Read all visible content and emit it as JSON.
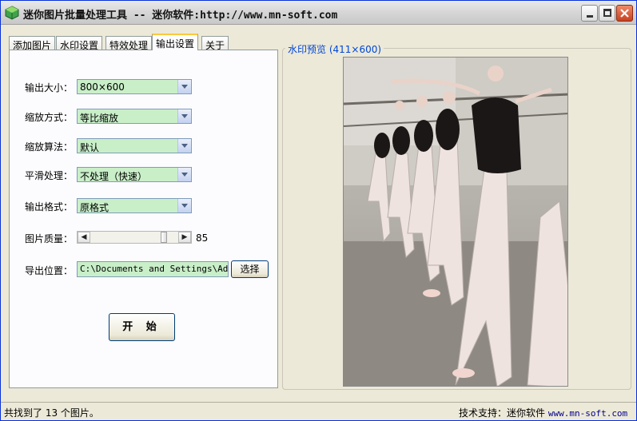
{
  "window": {
    "title": "迷你图片批量处理工具 -- 迷你软件:http://www.mn-soft.com"
  },
  "tabs": [
    {
      "label": "添加图片",
      "active": false
    },
    {
      "label": "水印设置",
      "active": false
    },
    {
      "label": "特效处理",
      "active": false
    },
    {
      "label": "输出设置",
      "active": true
    },
    {
      "label": "关于",
      "active": false
    }
  ],
  "output_settings": {
    "size_label": "输出大小：",
    "size_value": "800×600",
    "scale_mode_label": "缩放方式：",
    "scale_mode_value": "等比缩放",
    "scale_algo_label": "缩放算法：",
    "scale_algo_value": "默认",
    "smooth_label": "平滑处理：",
    "smooth_value": "不处理（快速）",
    "format_label": "输出格式：",
    "format_value": "原格式",
    "quality_label": "图片质量：",
    "quality_value": "85",
    "quality_level": 0.85,
    "export_label": "导出位置：",
    "export_path": "C:\\Documents and Settings\\Admir",
    "choose_button": "选择",
    "start_button": "开 始"
  },
  "preview": {
    "legend": "水印预览 (411×600)"
  },
  "status": {
    "found_text": "共找到了 13 个图片。",
    "support_label": "技术支持：迷你软件",
    "support_link": "www.mn-soft.com"
  }
}
